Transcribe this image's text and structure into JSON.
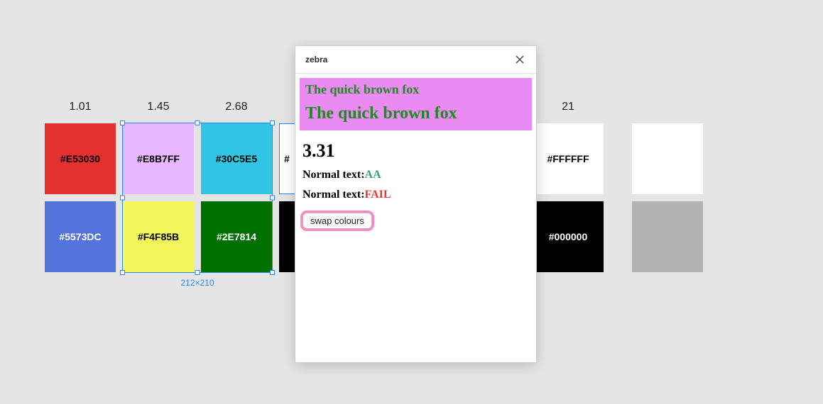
{
  "columns": [
    {
      "label": "1.01",
      "top": {
        "hex": "#E53030",
        "bg": "#e53030",
        "fg": "#000"
      },
      "bottom": {
        "hex": "#5573DC",
        "bg": "#5573dc",
        "fg": "#fff"
      }
    },
    {
      "label": "1.45",
      "top": {
        "hex": "#E8B7FF",
        "bg": "#e8b7ff",
        "fg": "#000"
      },
      "bottom": {
        "hex": "#F4F85B",
        "bg": "#f4f85b",
        "fg": "#000"
      }
    },
    {
      "label": "2.68",
      "top": {
        "hex": "#30C5E5",
        "bg": "#30c5e5",
        "fg": "#000"
      },
      "bottom": {
        "hex": "#2E7814",
        "bg": "#2e7814",
        "fg": "#fff"
      }
    },
    {
      "label": "21",
      "top": {
        "hex": "#FFFFFF",
        "bg": "#ffffff",
        "fg": "#000"
      },
      "bottom": {
        "hex": "#000000",
        "bg": "#000000",
        "fg": "#fff"
      }
    }
  ],
  "grey_column": {
    "top_bg": "#ffffff",
    "bottom_bg": "#b3b3b3"
  },
  "peek": {
    "text": "#"
  },
  "selection": {
    "size_label": "212×210"
  },
  "panel": {
    "title": "zebra",
    "sample_text": "The quick brown fox",
    "sample_bg": "#e98bf3",
    "sample_fg": "#1e8a1e",
    "ratio": "3.31",
    "normal_label": "Normal text:",
    "result_aa": "AA",
    "result_fail": "FAIL",
    "swap_label": "swap colours"
  }
}
